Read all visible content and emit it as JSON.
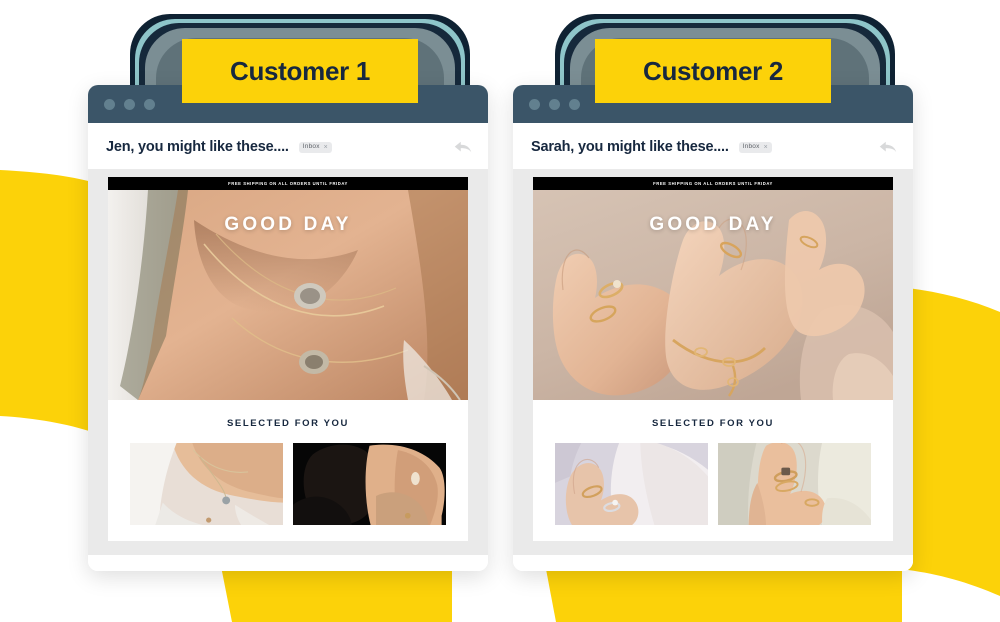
{
  "theme": {
    "accent_yellow": "#fcd209",
    "navy": "#17283f",
    "chrome_slate": "#3b5568",
    "canvas_gray": "#eaeaea"
  },
  "panels": [
    {
      "label": "Customer 1",
      "window": {
        "dots": [
          "dot-1",
          "dot-2",
          "dot-3"
        ],
        "subject": "Jen, you might like these....",
        "tag": "Inbox",
        "tag_close": "×",
        "reply_icon": "reply-arrow-icon"
      },
      "email": {
        "promo": "FREE SHIPPING ON ALL ORDERS UNTIL FRIDAY",
        "hero_title": "GOOD DAY",
        "hero_alt": "necklace-hero-image",
        "section_title": "SELECTED FOR YOU",
        "thumbs": [
          "necklace-thumbnail",
          "earring-thumbnail"
        ]
      }
    },
    {
      "label": "Customer 2",
      "window": {
        "dots": [
          "dot-1",
          "dot-2",
          "dot-3"
        ],
        "subject": "Sarah, you might like these....",
        "tag": "Inbox",
        "tag_close": "×",
        "reply_icon": "reply-arrow-icon"
      },
      "email": {
        "promo": "FREE SHIPPING ON ALL ORDERS UNTIL FRIDAY",
        "hero_title": "GOOD DAY",
        "hero_alt": "rings-hero-image",
        "section_title": "SELECTED FOR YOU",
        "thumbs": [
          "ring-thumbnail-left",
          "ring-thumbnail-right"
        ]
      }
    }
  ]
}
